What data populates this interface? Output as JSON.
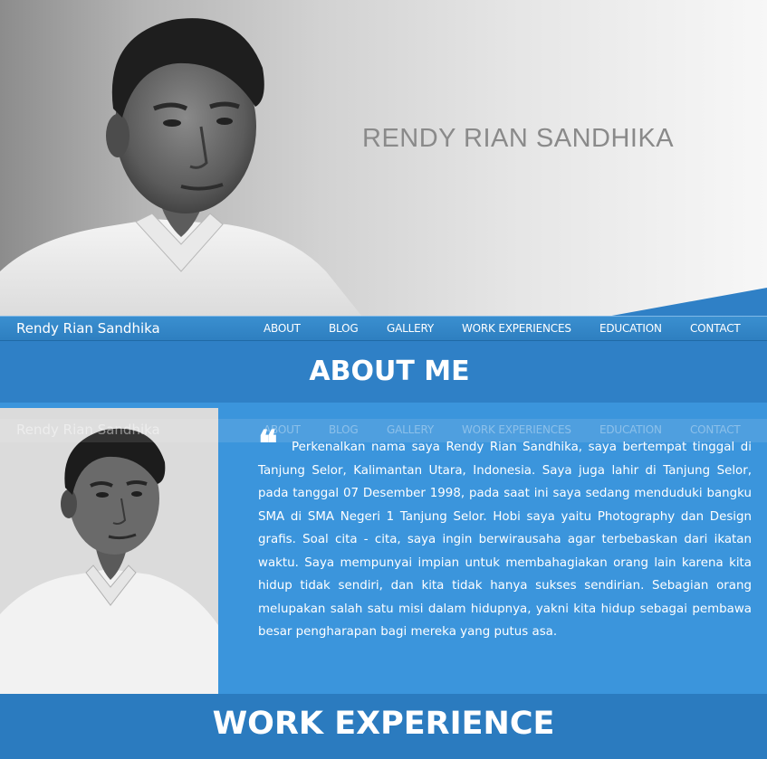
{
  "hero": {
    "name": "RENDY RIAN SANDHIKA"
  },
  "navbar": {
    "brand": "Rendy Rian Sandhika",
    "items": [
      {
        "label": "ABOUT"
      },
      {
        "label": "BLOG"
      },
      {
        "label": "GALLERY"
      },
      {
        "label": "WORK EXPERIENCES"
      },
      {
        "label": "EDUCATION"
      },
      {
        "label": "CONTACT"
      }
    ]
  },
  "about": {
    "title": "ABOUT ME",
    "quote_mark": "❝",
    "text": "Perkenalkan nama saya Rendy Rian Sandhika, saya bertempat tinggal di Tanjung Selor, Kalimantan Utara, Indonesia. Saya juga lahir di Tanjung Selor, pada tanggal 07 Desember 1998, pada saat ini saya sedang menduduki bangku SMA di SMA Negeri 1 Tanjung Selor. Hobi saya yaitu Photography dan Design grafis. Soal cita - cita, saya ingin berwirausaha agar terbebaskan dari ikatan waktu. Saya mempunyai impian untuk membahagiakan orang lain karena kita hidup tidak sendiri, dan kita tidak hanya sukses sendirian. Sebagian orang melupakan salah satu misi dalam hidupnya, yakni kita hidup sebagai pembawa besar pengharapan bagi mereka yang putus asa."
  },
  "work": {
    "title": "WORK EXPERIENCE"
  },
  "colors": {
    "nav_blue": "#2e7fc0",
    "about_header": "#2f80c6",
    "about_body": "#3b95dc",
    "work_header": "#2b7bbf",
    "hero_name": "#8a8a8a"
  },
  "icons": {
    "hero_photo": "portrait-photo",
    "about_photo": "portrait-photo"
  }
}
